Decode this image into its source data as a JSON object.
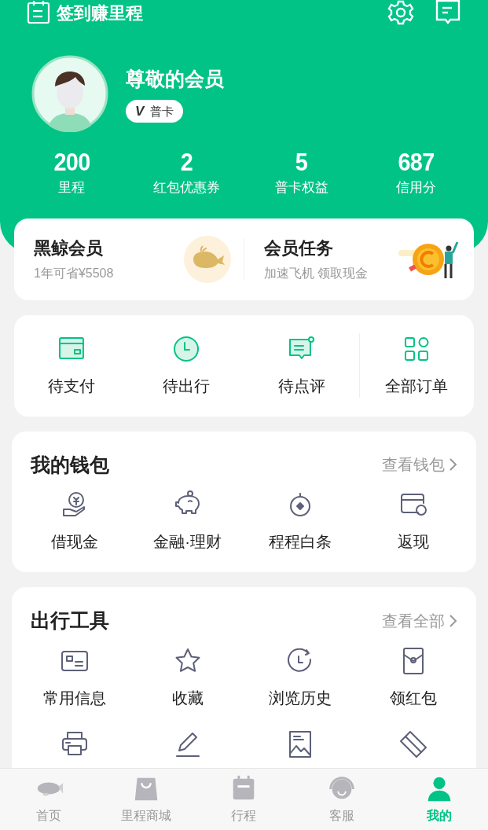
{
  "top_bar": {
    "checkin": "签到赚里程"
  },
  "profile": {
    "name": "尊敬的会员",
    "badge_mark": "V",
    "badge": "普卡"
  },
  "stats": [
    {
      "value": "200",
      "label": "里程"
    },
    {
      "value": "2",
      "label": "红包优惠券"
    },
    {
      "value": "5",
      "label": "普卡权益"
    },
    {
      "value": "687",
      "label": "信用分"
    }
  ],
  "promos": [
    {
      "title": "黑鲸会员",
      "subtitle": "1年可省¥5508"
    },
    {
      "title": "会员任务",
      "subtitle": "加速飞机 领取现金"
    }
  ],
  "orders": [
    {
      "label": "待支付"
    },
    {
      "label": "待出行"
    },
    {
      "label": "待点评"
    },
    {
      "label": "全部订单"
    }
  ],
  "wallet": {
    "title": "我的钱包",
    "link": "查看钱包",
    "items": [
      {
        "label": "借现金"
      },
      {
        "label": "金融·理财"
      },
      {
        "label": "程程白条"
      },
      {
        "label": "返现"
      }
    ]
  },
  "tools": {
    "title": "出行工具",
    "link": "查看全部",
    "items": [
      {
        "label": "常用信息"
      },
      {
        "label": "收藏"
      },
      {
        "label": "浏览历史"
      },
      {
        "label": "领红包"
      }
    ]
  },
  "tab_bar": [
    {
      "label": "首页",
      "selected": false
    },
    {
      "label": "里程商城",
      "selected": false
    },
    {
      "label": "行程",
      "selected": false
    },
    {
      "label": "客服",
      "selected": false
    },
    {
      "label": "我的",
      "selected": true
    }
  ]
}
